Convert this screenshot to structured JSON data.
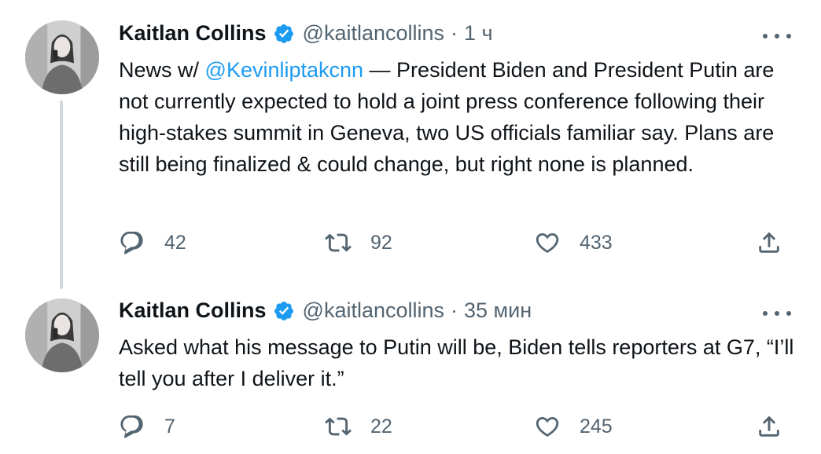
{
  "tweets": [
    {
      "name": "Kaitlan Collins",
      "handle": "@kaitlancollins",
      "separator": "·",
      "time": "1 ч",
      "text_before": "News w/ ",
      "mention": "@Kevinliptakcnn",
      "text_after": " — President Biden and President Putin are not currently expected to hold a joint press conference following their high-stakes summit in Geneva, two US officials familiar say. Plans are still being finalized & could change, but right none is planned.",
      "replies": "42",
      "retweets": "92",
      "likes": "433"
    },
    {
      "name": "Kaitlan Collins",
      "handle": "@kaitlancollins",
      "separator": "·",
      "time": "35 мин",
      "text": "Asked what his message to Putin will be, Biden tells reporters at G7, “I’ll tell you after I deliver it.”",
      "replies": "7",
      "retweets": "22",
      "likes": "245"
    }
  ],
  "icons": {
    "verified": "verified-badge-icon",
    "more": "more-horizontal-icon",
    "reply": "reply-icon",
    "retweet": "retweet-icon",
    "like": "heart-icon",
    "share": "share-icon"
  },
  "colors": {
    "accent": "#1d9bf0",
    "secondary_text": "#536471",
    "thread_line": "#cfd9de"
  }
}
